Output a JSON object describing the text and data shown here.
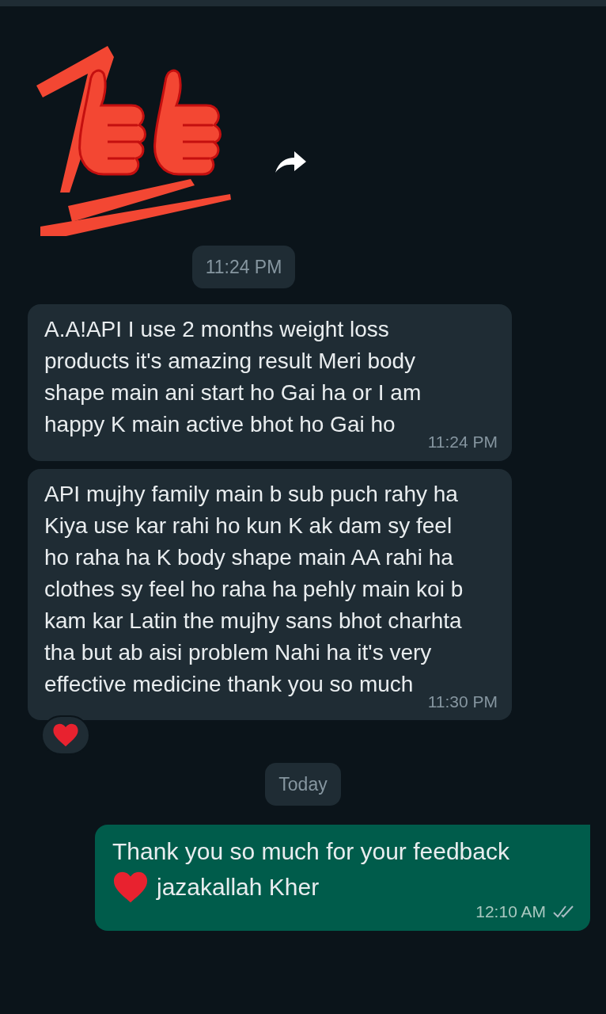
{
  "messages": [
    {
      "kind": "date",
      "text": "11:24 PM"
    },
    {
      "kind": "incoming",
      "text": "A.A!API I use 2 months weight loss products it's amazing result Meri body shape main ani start ho Gai ha or I am happy K main active bhot ho Gai ho",
      "time": "11:24 PM",
      "reacted": false
    },
    {
      "kind": "incoming",
      "text": "API mujhy family main b sub puch rahy ha Kiya use kar rahi ho kun K ak dam sy feel ho raha ha K body shape main AA rahi ha clothes sy feel ho raha ha pehly main koi b kam kar Latin the mujhy sans bhot charhta tha but ab aisi problem Nahi ha it's very effective medicine thank you so much",
      "time": "11:30 PM",
      "reacted": true
    },
    {
      "kind": "date",
      "text": "Today"
    },
    {
      "kind": "outgoing",
      "text": "Thank you so much for your feedback",
      "text_after_heart": "jazakallah Kher",
      "time": "12:10 AM",
      "read": false
    }
  ]
}
